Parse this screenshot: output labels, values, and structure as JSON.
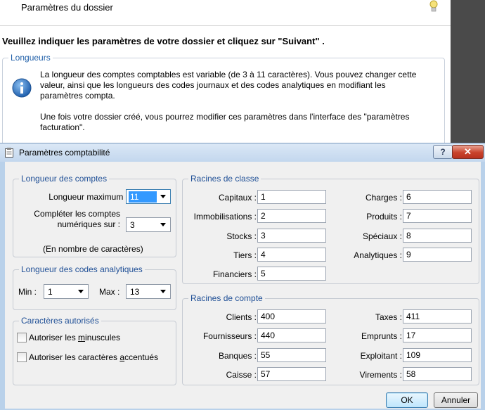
{
  "background": {
    "header_title": "Paramètres du dossier",
    "instruction": "Veuillez indiquer les paramètres de votre dossier et cliquez sur \"Suivant\" .",
    "group_title": "Longueurs",
    "info_p1": "La longueur des comptes comptables est variable (de 3 à 11 caractères). Vous pouvez changer cette valeur, ainsi que les longueurs des codes journaux et des codes analytiques en modifiant les paramètres compta.",
    "info_p2": "Une fois votre dossier créé, vous pourrez modifier ces paramètres dans l'interface des \"paramètres facturation\"."
  },
  "dialog": {
    "title": "Paramètres comptabilité",
    "help_label": "?",
    "close_label": "✕"
  },
  "longueur_comptes": {
    "legend": "Longueur des comptes",
    "max_label": "Longueur maximum :",
    "max_value": "11",
    "completer_label_1": "Compléter les comptes",
    "completer_label_2": "numériques sur :",
    "completer_value": "3",
    "note": "(En nombre de caractères)"
  },
  "codes_analytiques": {
    "legend": "Longueur des codes analytiques",
    "min_label": "Min :",
    "min_value": "1",
    "max_label": "Max :",
    "max_value": "13"
  },
  "caracteres": {
    "legend": "Caractères autorisés",
    "minuscules_pre": "Autoriser les ",
    "minuscules_u": "m",
    "minuscules_post": "inuscules",
    "accentues_pre": "Autoriser les caractères ",
    "accentues_u": "a",
    "accentues_post": "ccentués"
  },
  "racines_classe": {
    "legend": "Racines de classe",
    "left": [
      {
        "label": "Capitaux :",
        "value": "1"
      },
      {
        "label": "Immobilisations :",
        "value": "2"
      },
      {
        "label": "Stocks :",
        "value": "3"
      },
      {
        "label": "Tiers :",
        "value": "4"
      },
      {
        "label": "Financiers :",
        "value": "5"
      }
    ],
    "right": [
      {
        "label": "Charges :",
        "value": "6"
      },
      {
        "label": "Produits :",
        "value": "7"
      },
      {
        "label": "Spéciaux :",
        "value": "8"
      },
      {
        "label": "Analytiques :",
        "value": "9"
      }
    ]
  },
  "racines_compte": {
    "legend": "Racines de compte",
    "left": [
      {
        "label": "Clients :",
        "value": "400"
      },
      {
        "label": "Fournisseurs :",
        "value": "440"
      },
      {
        "label": "Banques :",
        "value": "55"
      },
      {
        "label": "Caisse :",
        "value": "57"
      }
    ],
    "right": [
      {
        "label": "Taxes :",
        "value": "411"
      },
      {
        "label": "Emprunts :",
        "value": "17"
      },
      {
        "label": "Exploitant :",
        "value": "109"
      },
      {
        "label": "Virements :",
        "value": "58"
      }
    ]
  },
  "buttons": {
    "ok": "OK",
    "cancel": "Annuler"
  }
}
